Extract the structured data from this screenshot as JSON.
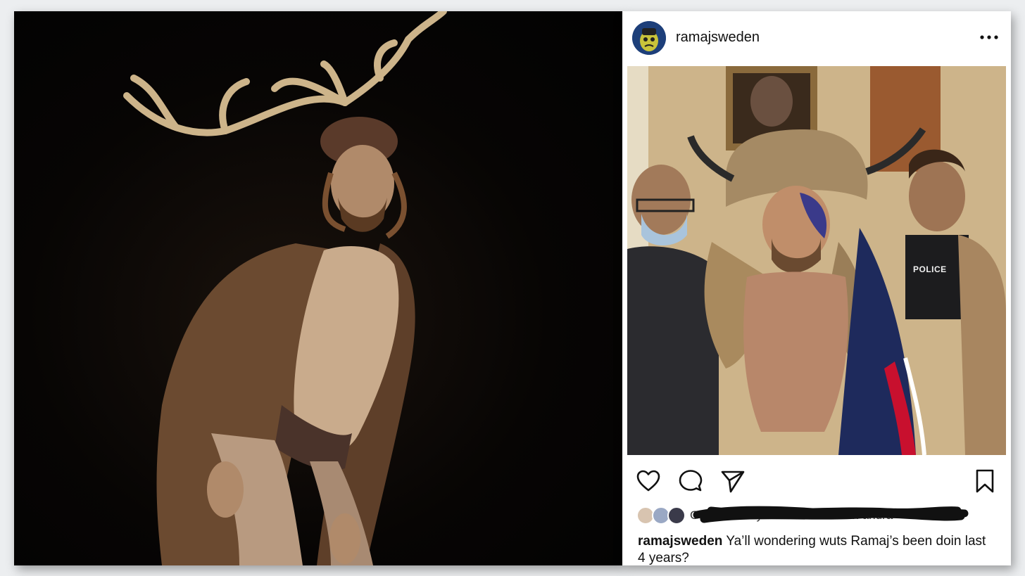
{
  "post": {
    "username": "ramajsweden",
    "liked_by": "Gilla av fannytwardomanski och andra",
    "caption_user": "ramajsweden",
    "caption_text": " Ya’ll wondering wuts Ramaj’s been doin last 4 years?",
    "police_label": "POLICE"
  },
  "icons": {
    "more": "more-dots-icon",
    "like": "heart-icon",
    "comment": "comment-icon",
    "share": "send-icon",
    "save": "bookmark-icon"
  },
  "colors": {
    "page_bg": "#eceef0",
    "card_bg": "#ffffff",
    "text": "#111111",
    "scribble": "#111111"
  }
}
